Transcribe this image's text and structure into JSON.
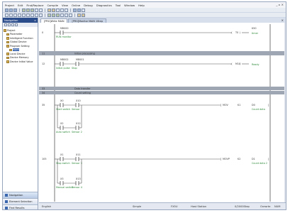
{
  "menu": [
    "Project",
    "Edit",
    "Find/Replace",
    "Compile",
    "View",
    "Online",
    "Debug",
    "Diagnostics",
    "Tool",
    "Window",
    "Help"
  ],
  "window_controls": "_ ▫ ×",
  "sidebar": {
    "title": "Navigation",
    "close": "×",
    "tree": [
      {
        "label": "Project",
        "level": 0
      },
      {
        "label": "Parameter",
        "level": 1
      },
      {
        "label": "Intelligent Function",
        "level": 1
      },
      {
        "label": "Global Device",
        "level": 1
      },
      {
        "label": "Program Setting",
        "level": 1
      },
      {
        "label": "MAIN",
        "level": 2
      },
      {
        "label": "Local Device",
        "level": 1
      },
      {
        "label": "Device Memory",
        "level": 1
      },
      {
        "label": "Device Initial Value",
        "level": 1
      }
    ],
    "bottom_buttons": [
      {
        "label": "Navigation",
        "current": true
      },
      {
        "label": "Element Selection",
        "current": false
      },
      {
        "label": "Find Results",
        "current": false
      }
    ]
  },
  "tabs": [
    {
      "label": "[PRG]Write MAIN",
      "active": true
    },
    {
      "label": "[PRG]Monitor MAIN 1Step",
      "active": false
    }
  ],
  "ladder": {
    "rungs": [
      {
        "step": "0",
        "contact": "M8000",
        "contact_comment": "RUN monitor",
        "coil": "T0",
        "coil_value": "K50",
        "coil_comment": "timer"
      },
      {
        "step": "12",
        "contacts": [
          "M8002",
          "M8001"
        ],
        "contact_comments": [
          "Initial pulse",
          "Stop"
        ],
        "coil": "M10",
        "coil_comment": "Ready"
      },
      {
        "step": "35",
        "contacts": [
          "X0",
          "X10"
        ],
        "contact_comments": [
          "Start switch",
          "Sensor"
        ],
        "parallel": [
          "X2",
          "X12"
        ],
        "parallel_comments": [
          "Auto switch",
          "Sensor 2"
        ],
        "instruction": "MOV",
        "operands": [
          "K1",
          "D0"
        ],
        "operand_comment": "Count data"
      },
      {
        "step": "105",
        "contacts": [
          "X1",
          "X11"
        ],
        "contact_comments": [
          "Stop switch",
          "Sensor 3"
        ],
        "parallel": [
          "X3",
          "X13"
        ],
        "parallel_comments": [
          "Manual switch",
          "Sensor 4"
        ],
        "instruction": "MOVP",
        "operands": [
          "K2",
          "D1"
        ],
        "operand_comment": "Count data 2"
      }
    ],
    "comments": [
      {
        "step": "11",
        "text": "Initial processing"
      },
      {
        "step": "33",
        "text": "Data transfer"
      },
      {
        "step": "34",
        "text": "Count setting"
      }
    ]
  },
  "status": {
    "language": "English",
    "mode": "Simple",
    "cpu": "FX5U",
    "host": "Host Station",
    "steps": "0/2000Step",
    "ovr": "Ovrwrte",
    "num": "NUM"
  }
}
